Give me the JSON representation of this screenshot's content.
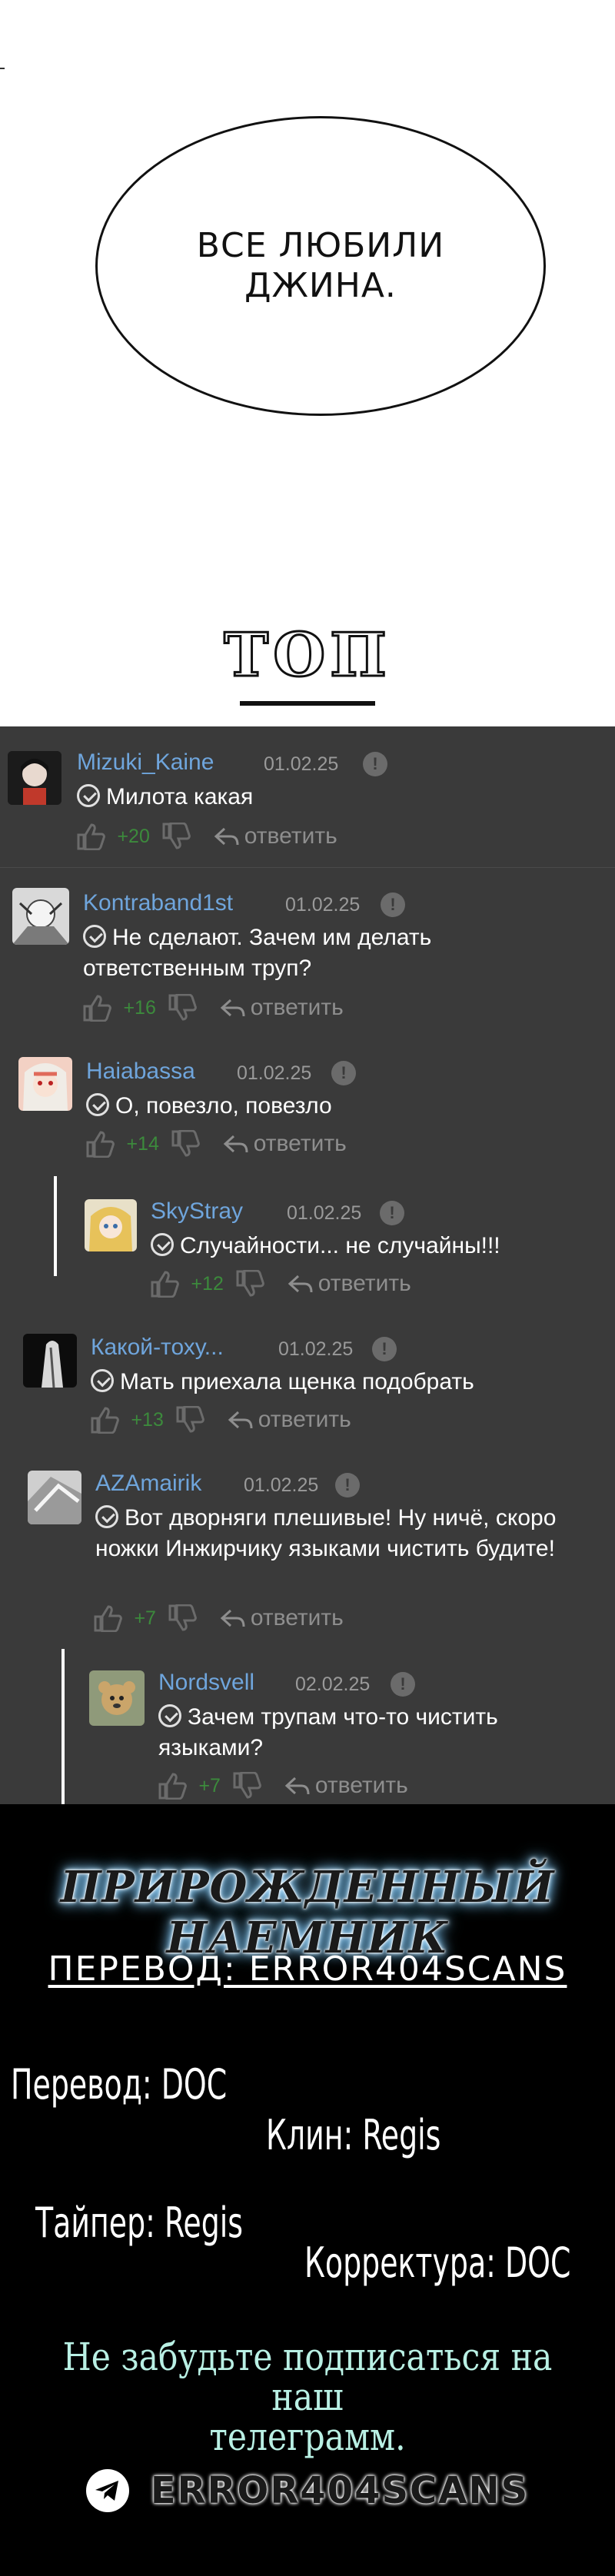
{
  "bubble_text": [
    "ВСЕ ЛЮБИЛИ",
    "ДЖИНА."
  ],
  "top_word": "ТОП",
  "comments": [
    {
      "username": "Mizuki_Kaine",
      "date": "01.02.25",
      "text": "Милота какая",
      "score": "+20",
      "reply": "ответить"
    },
    {
      "username": "Kontraband1st",
      "date": "01.02.25",
      "text": "Не сделают. Зачем им делать ответственным труп?",
      "score": "+16",
      "reply": "ответить"
    },
    {
      "username": "Haiabassa",
      "date": "01.02.25",
      "text": "О, повезло, повезло",
      "score": "+14",
      "reply": "ответить"
    },
    {
      "username": "SkyStray",
      "date": "01.02.25",
      "text": "Случайности... не случайны!!!",
      "score": "+12",
      "reply": "ответить"
    },
    {
      "username": "Какой-тоху...",
      "date": "01.02.25",
      "text": "Мать приехала щенка подобрать",
      "score": "+13",
      "reply": "ответить"
    },
    {
      "username": "AZAmairik",
      "date": "01.02.25",
      "text": "Вот дворняги плешивые! Ну ничё, скоро ножки Инжирчику языками чистить будите!",
      "score": "+7",
      "reply": "ответить"
    },
    {
      "username": "Nordsvell",
      "date": "02.02.25",
      "text": "Зачем трупам что-то чистить языками?",
      "score": "+7",
      "reply": "ответить"
    }
  ],
  "credits": {
    "series_title": "ПРИРОЖДЕННЫЙ НАЕМНИК",
    "translation_team": "ПЕРЕВОД: ERROR404SCANS",
    "translation": "Перевод: DOC",
    "clean": "Клин: Regis",
    "typer": "Тайпер: Regis",
    "proofreading": "Корректура: DOC",
    "reminder": [
      "Не забудьте подписаться на наш",
      "телеграмм."
    ],
    "telegram_handle": "ERROR404SCANS"
  },
  "colors": {
    "comments_bg": "#3a3a3a",
    "username": "#6fa5dc",
    "score": "#3c8a3c",
    "credits_bg": "#000000",
    "reminder": "#b9f0e4"
  }
}
